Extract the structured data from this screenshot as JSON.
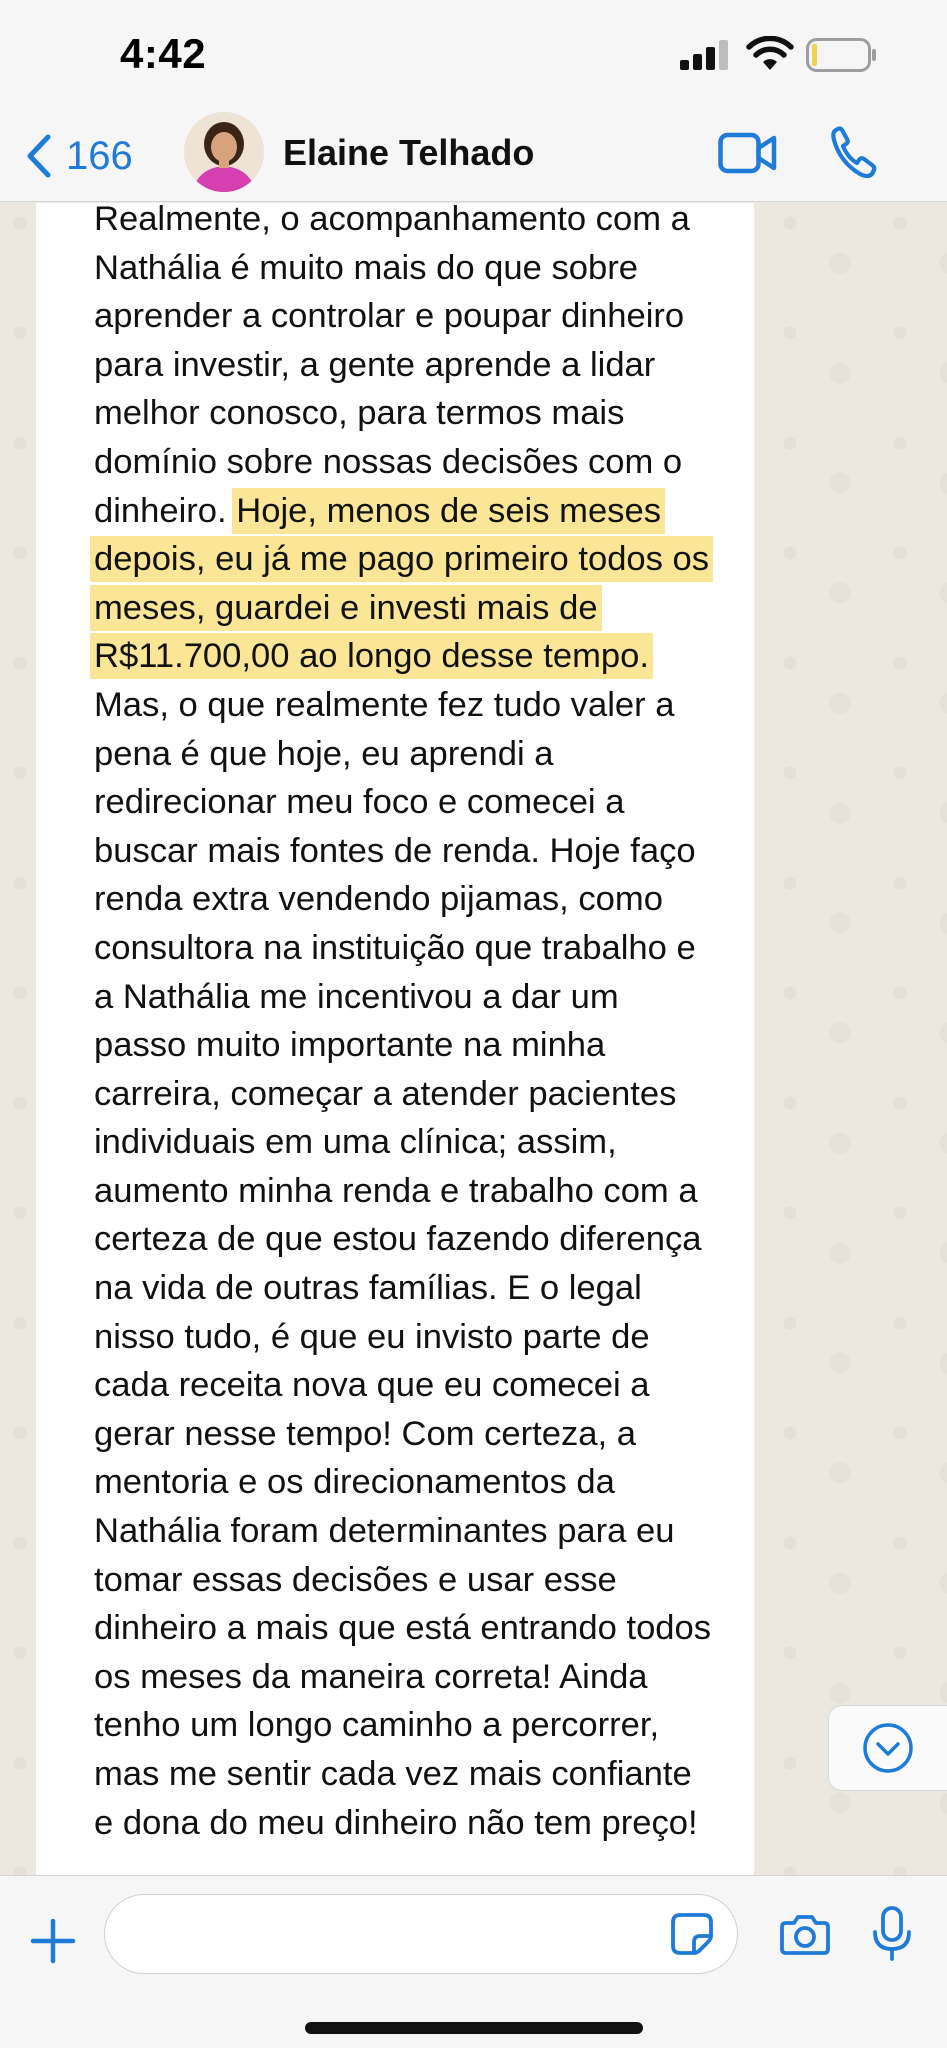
{
  "status_bar": {
    "time": "4:42"
  },
  "header": {
    "back_count": "166",
    "contact_name": "Elaine Telhado"
  },
  "message": {
    "lines": [
      {
        "text": "Realmente, o acompanhamento com a"
      },
      {
        "text": "Nathália é muito mais do que sobre"
      },
      {
        "text": "aprender a controlar e poupar dinheiro"
      },
      {
        "text": "para investir, a gente aprende a lidar"
      },
      {
        "text": "melhor conosco, para termos mais"
      },
      {
        "text": "domínio sobre nossas decisões com o"
      },
      {
        "text": "dinheiro. ",
        "highlight": "Hoje, menos de seis meses"
      },
      {
        "text": "",
        "highlight": "depois, eu já me pago primeiro todos os"
      },
      {
        "text": "",
        "highlight": "meses, guardei e investi mais de"
      },
      {
        "text": "",
        "highlight": "R$11.700,00 ao longo desse tempo."
      },
      {
        "text": "Mas, o que realmente fez tudo valer a"
      },
      {
        "text": "pena é que hoje, eu aprendi a"
      },
      {
        "text": "redirecionar meu foco e comecei a"
      },
      {
        "text": "buscar mais fontes de renda. Hoje faço"
      },
      {
        "text": "renda extra vendendo pijamas, como"
      },
      {
        "text": "consultora na instituição que trabalho e"
      },
      {
        "text": "a Nathália me incentivou a dar um"
      },
      {
        "text": "passo muito importante na minha"
      },
      {
        "text": "carreira, começar a atender pacientes"
      },
      {
        "text": "individuais em uma clínica; assim,"
      },
      {
        "text": "aumento minha renda e trabalho com a"
      },
      {
        "text": "certeza de que estou fazendo diferença"
      },
      {
        "text": "na vida de outras famílias. E o legal"
      },
      {
        "text": "nisso tudo, é que eu invisto parte de"
      },
      {
        "text": "cada receita nova que eu comecei a"
      },
      {
        "text": "gerar nesse tempo! Com certeza, a"
      },
      {
        "text": "mentoria e os direcionamentos da"
      },
      {
        "text": "Nathália foram determinantes para eu"
      },
      {
        "text": "tomar essas decisões e usar esse"
      },
      {
        "text": "dinheiro a mais que está entrando todos"
      },
      {
        "text": "os meses da maneira correta! Ainda"
      },
      {
        "text": "tenho um longo caminho a percorrer,"
      },
      {
        "text": "mas me sentir cada vez mais confiante"
      },
      {
        "text": "e dona do meu dinheiro não tem preço!"
      }
    ]
  },
  "input": {
    "value": "",
    "placeholder": ""
  },
  "icons": {
    "back": "chevron-left-icon",
    "video": "video-camera-icon",
    "call": "phone-icon",
    "scroll": "chevron-down-circle-icon",
    "plus": "plus-icon",
    "sticker": "sticker-icon",
    "camera": "camera-icon",
    "mic": "microphone-icon"
  },
  "colors": {
    "accent": "#1f7bd8",
    "highlight": "#fbe597",
    "bubble": "#ffffff",
    "chat_background": "#ece7df"
  }
}
